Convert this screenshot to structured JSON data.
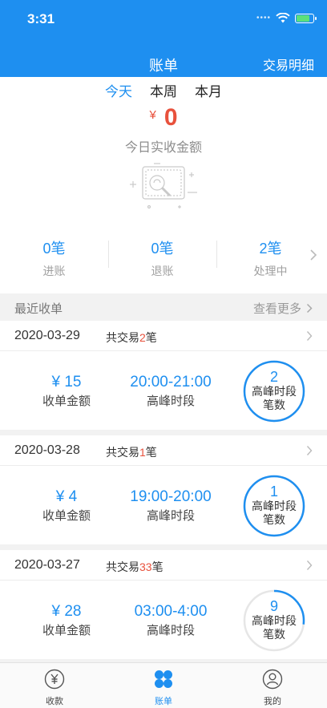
{
  "status_bar": {
    "time": "3:31"
  },
  "nav": {
    "title": "账单",
    "right_link": "交易明细"
  },
  "period_tabs": [
    {
      "label": "今天",
      "active": true
    },
    {
      "label": "本周",
      "active": false
    },
    {
      "label": "本月",
      "active": false
    }
  ],
  "summary": {
    "currency": "¥",
    "amount": "0",
    "amount_label": "今日实收金额",
    "stats": [
      {
        "value": "0笔",
        "label": "进账"
      },
      {
        "value": "0笔",
        "label": "退账"
      },
      {
        "value": "2笔",
        "label": "处理中"
      }
    ]
  },
  "recent": {
    "title": "最近收单",
    "more": "查看更多"
  },
  "cards": [
    {
      "date": "2020-03-29",
      "count_prefix": "共交易",
      "count": "2",
      "count_suffix": "笔",
      "amount": "¥ 15",
      "amount_label": "收单金额",
      "peak_time": "20:00-21:00",
      "peak_label": "高峰时段",
      "peak_count": "2",
      "peak_count_label1": "高峰时段",
      "peak_count_label2": "笔数",
      "ring_progress": 1.0
    },
    {
      "date": "2020-03-28",
      "count_prefix": "共交易",
      "count": "1",
      "count_suffix": "笔",
      "amount": "¥ 4",
      "amount_label": "收单金额",
      "peak_time": "19:00-20:00",
      "peak_label": "高峰时段",
      "peak_count": "1",
      "peak_count_label1": "高峰时段",
      "peak_count_label2": "笔数",
      "ring_progress": 1.0
    },
    {
      "date": "2020-03-27",
      "count_prefix": "共交易",
      "count": "33",
      "count_suffix": "笔",
      "amount": "¥ 28",
      "amount_label": "收单金额",
      "peak_time": "03:00-4:00",
      "peak_label": "高峰时段",
      "peak_count": "9",
      "peak_count_label1": "高峰时段",
      "peak_count_label2": "笔数",
      "ring_progress": 0.27
    }
  ],
  "tabbar": [
    {
      "label": "收款",
      "icon": "yen-circle-icon",
      "active": false
    },
    {
      "label": "账单",
      "icon": "four-petal-icon",
      "active": true
    },
    {
      "label": "我的",
      "icon": "user-circle-icon",
      "active": false
    }
  ],
  "colors": {
    "primary": "#1e8ff0",
    "accent_red": "#e8513c",
    "ring_track": "#e6e6e6"
  }
}
